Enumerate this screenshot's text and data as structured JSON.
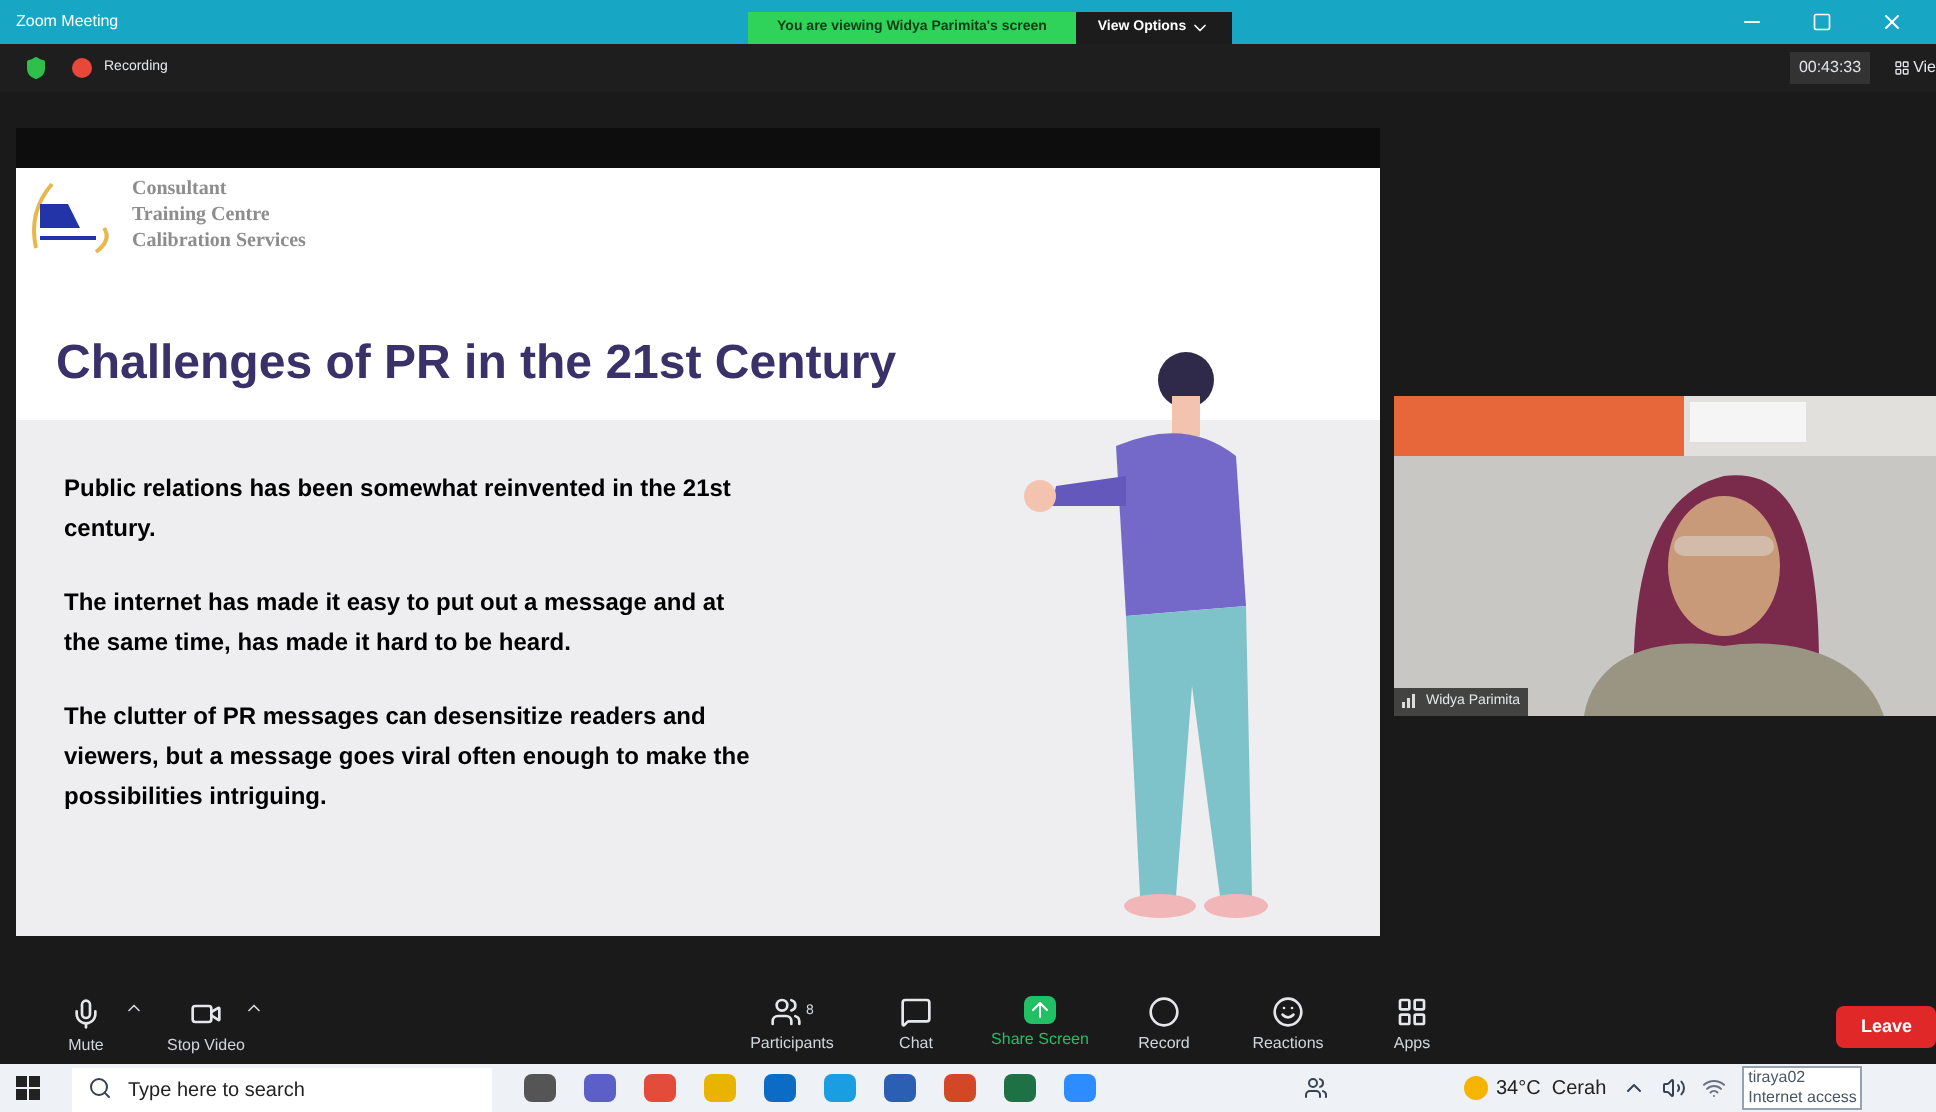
{
  "window": {
    "title": "Zoom Meeting",
    "banner": "You are viewing Widya Parimita's screen",
    "view_options": "View Options"
  },
  "status": {
    "recording": "Recording",
    "timer": "00:43:33",
    "view": "Vie"
  },
  "slide": {
    "logo_lines": [
      "Consultant",
      "Training Centre",
      "Calibration Services"
    ],
    "title": "Challenges of PR in the 21st Century",
    "paragraphs": [
      "Public relations has been somewhat reinvented in the 21st century.",
      "The internet has made it easy to put out a message and at the same time, has made it hard to be heard.",
      "The clutter of PR messages can desensitize readers and viewers, but a message goes viral often enough to make the possibilities intriguing."
    ]
  },
  "video": {
    "kind": "picture",
    "name": "Widya Parimita"
  },
  "toolbar": {
    "left": [
      {
        "kind": "mic",
        "label": "Mute"
      },
      {
        "kind": "camera",
        "label": "Stop Video"
      }
    ],
    "center": [
      {
        "kind": "participants",
        "label": "Participants",
        "count": "8"
      },
      {
        "kind": "chat",
        "label": "Chat"
      },
      {
        "kind": "share",
        "label": "Share Screen"
      },
      {
        "kind": "record",
        "label": "Record"
      },
      {
        "kind": "reactions",
        "label": "Reactions"
      },
      {
        "kind": "apps",
        "label": "Apps"
      }
    ],
    "leave": "Leave"
  },
  "taskbar": {
    "search_placeholder": "Type here to search",
    "weather": "34°C  Cerah",
    "tooltip": [
      "tiraya02",
      "Internet access"
    ]
  }
}
